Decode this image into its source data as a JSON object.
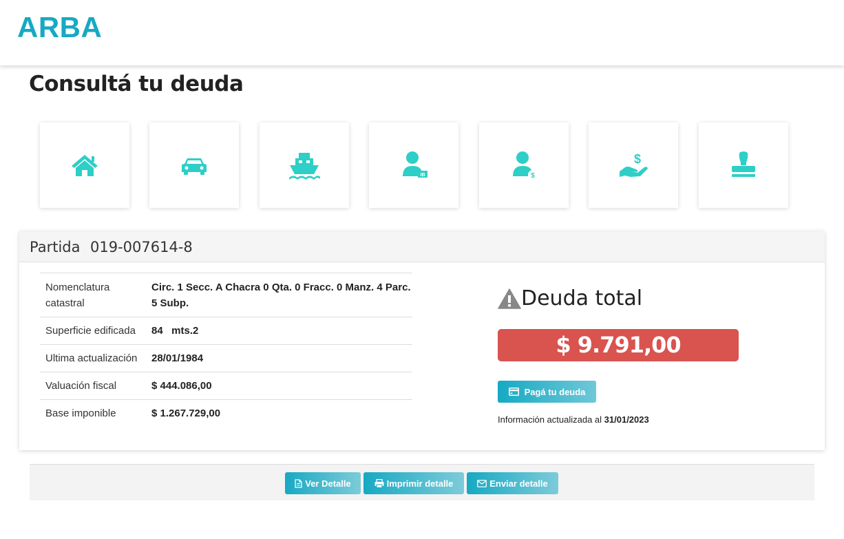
{
  "header": {
    "logo_text": "ARBA",
    "brand_color": "#17a9c3"
  },
  "page": {
    "title": "Consultá tu deuda"
  },
  "categories": [
    {
      "icon": "house-icon"
    },
    {
      "icon": "car-icon"
    },
    {
      "icon": "boat-icon"
    },
    {
      "icon": "person-ib-icon"
    },
    {
      "icon": "person-dollar-icon"
    },
    {
      "icon": "hand-dollar-icon"
    },
    {
      "icon": "stamp-icon"
    }
  ],
  "partida": {
    "label": "Partida",
    "number": "019-007614-8",
    "rows": [
      {
        "label": "Nomenclatura catastral",
        "value": "Circ. 1 Secc. A Chacra 0 Qta. 0 Fracc. 0 Manz. 4 Parc. 5 Subp."
      },
      {
        "label": "Superficie edificada",
        "value": "84   mts.2"
      },
      {
        "label": "Ultima actualización",
        "value": "28/01/1984"
      },
      {
        "label": "Valuación fiscal",
        "value": "$ 444.086,00"
      },
      {
        "label": "Base imponible",
        "value": "$ 1.267.729,00"
      }
    ]
  },
  "debt": {
    "title": "Deuda total",
    "amount": "$ 9.791,00",
    "pay_label": "Pagá tu deuda",
    "updated_prefix": "Información actualizada al",
    "updated_date": "31/01/2023",
    "amount_color": "#d9534f",
    "warning_icon": "warning-icon"
  },
  "actions": {
    "ver_detalle": "Ver Detalle",
    "imprimir_detalle": "Imprimir detalle",
    "enviar_detalle": "Enviar detalle"
  }
}
